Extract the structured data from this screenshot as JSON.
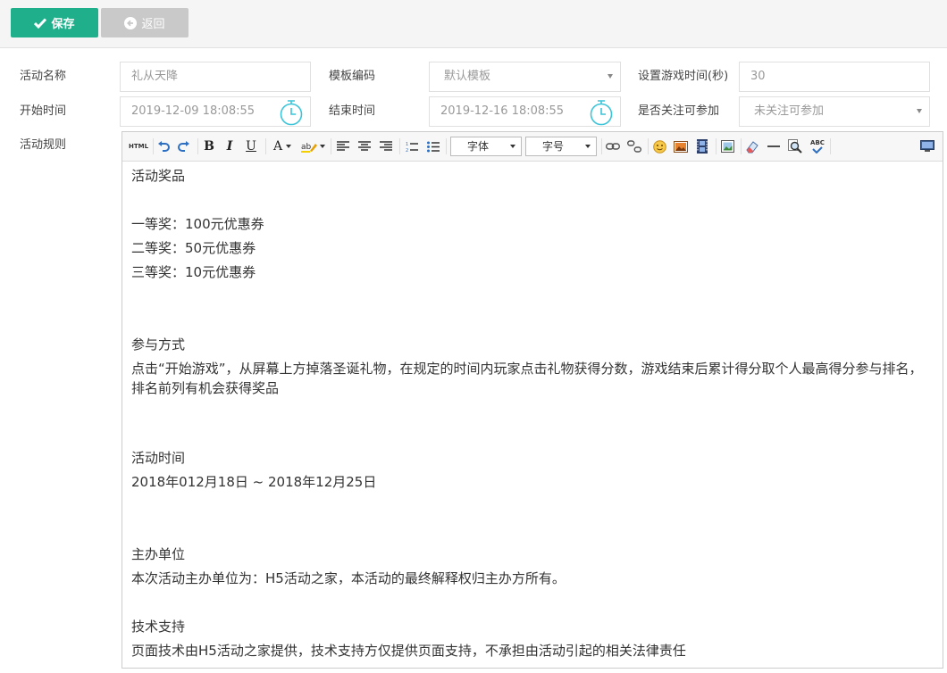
{
  "toolbar": {
    "save_label": "保存",
    "back_label": "返回"
  },
  "form": {
    "activity_name": {
      "label": "活动名称",
      "placeholder": "礼从天降"
    },
    "template_code": {
      "label": "模板编码",
      "value": "默认模板"
    },
    "game_time": {
      "label": "设置游戏时间(秒)",
      "placeholder": "30"
    },
    "start_time": {
      "label": "开始时间",
      "value": "2019-12-09 18:08:55"
    },
    "end_time": {
      "label": "结束时间",
      "value": "2019-12-16 18:08:55"
    },
    "follow_required": {
      "label": "是否关注可参加",
      "value": "未关注可参加"
    },
    "rules": {
      "label": "活动规则"
    }
  },
  "editor": {
    "font_select": "字体",
    "size_select": "字号",
    "html_label": "HTML",
    "bold": "B",
    "italic": "I",
    "underline": "U",
    "font_color": "A",
    "spell_label": "ABC",
    "paragraphs": [
      "活动奖品",
      "",
      "一等奖：100元优惠券",
      "二等奖：50元优惠券",
      "三等奖：10元优惠券",
      "",
      "",
      "参与方式",
      "点击“开始游戏”，从屏幕上方掉落圣诞礼物，在规定的时间内玩家点击礼物获得分数，游戏结束后累计得分取个人最高得分参与排名，排名前列有机会获得奖品",
      "",
      "",
      "活动时间",
      "2018年012月18日  ~ 2018年12月25日",
      "",
      "",
      "主办单位",
      "本次活动主办单位为：H5活动之家，本活动的最终解释权归主办方所有。",
      "",
      "技术支持",
      "页面技术由H5活动之家提供，技术支持方仅提供页面支持，不承担由活动引起的相关法律责任"
    ]
  },
  "colors": {
    "accent": "#1fb08b",
    "disabled": "#c9c9c9",
    "clock": "#3cc4d8"
  }
}
